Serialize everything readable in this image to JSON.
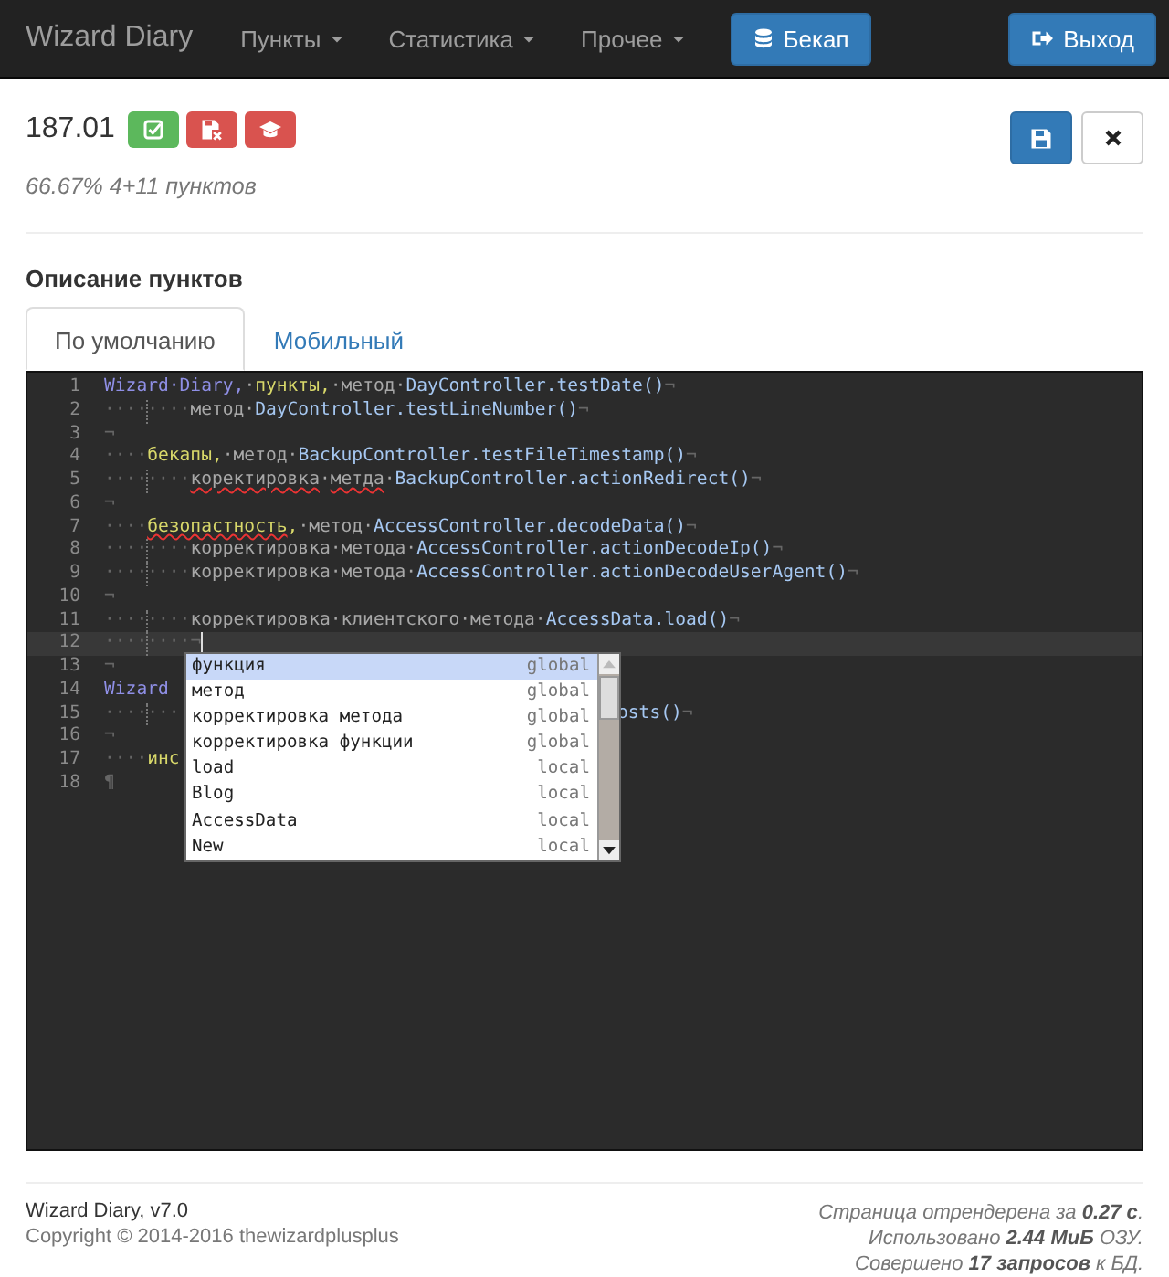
{
  "navbar": {
    "brand": "Wizard Diary",
    "menus": [
      {
        "label": "Пункты"
      },
      {
        "label": "Статистика"
      },
      {
        "label": "Прочее"
      }
    ],
    "backup_button": "Бекап",
    "logout_button": "Выход"
  },
  "header": {
    "title": "187.01",
    "summary": "66.67% 4+11 пунктов",
    "actions": [
      {
        "kind": "check",
        "color": "#5cb85c"
      },
      {
        "kind": "floppy-x",
        "color": "#d9534f"
      },
      {
        "kind": "cap",
        "color": "#d9534f"
      }
    ]
  },
  "section_title": "Описание пунктов",
  "tabs": [
    {
      "label": "По умолчанию",
      "selected": true
    },
    {
      "label": "Мобильный",
      "selected": false
    }
  ],
  "editor": {
    "lines": [
      {
        "number": "1",
        "active": false,
        "tokens": [
          {
            "kind": "title",
            "text": "Wizard·Diary,"
          },
          {
            "kind": "plain",
            "text": "·"
          },
          {
            "kind": "keyword",
            "text": "пункты,"
          },
          {
            "kind": "plain",
            "text": "·метод·"
          },
          {
            "kind": "ref",
            "text": "DayController.testDate()"
          },
          {
            "kind": "ws",
            "text": "¬"
          }
        ]
      },
      {
        "number": "2",
        "active": false,
        "tokens": [
          {
            "kind": "indent",
            "text": "····"
          },
          {
            "kind": "indent",
            "text": "····"
          },
          {
            "kind": "plain",
            "text": "метод·"
          },
          {
            "kind": "ref",
            "text": "DayController.testLineNumber()"
          },
          {
            "kind": "ws",
            "text": "¬"
          }
        ]
      },
      {
        "number": "3",
        "active": false,
        "tokens": [
          {
            "kind": "ws",
            "text": "¬"
          }
        ]
      },
      {
        "number": "4",
        "active": false,
        "tokens": [
          {
            "kind": "indent",
            "text": "····"
          },
          {
            "kind": "keyword",
            "text": "бекапы,"
          },
          {
            "kind": "plain",
            "text": "·метод·"
          },
          {
            "kind": "ref",
            "text": "BackupController.testFileTimestamp()"
          },
          {
            "kind": "ws",
            "text": "¬"
          }
        ]
      },
      {
        "number": "5",
        "active": false,
        "tokens": [
          {
            "kind": "indent",
            "text": "····"
          },
          {
            "kind": "indent",
            "text": "····"
          },
          {
            "kind": "plain",
            "text": "коректировка",
            "misspelled": true
          },
          {
            "kind": "plain",
            "text": "·"
          },
          {
            "kind": "plain",
            "text": "метда",
            "misspelled": true
          },
          {
            "kind": "plain",
            "text": "·"
          },
          {
            "kind": "ref",
            "text": "BackupController.actionRedirect()"
          },
          {
            "kind": "ws",
            "text": "¬"
          }
        ]
      },
      {
        "number": "6",
        "active": false,
        "tokens": [
          {
            "kind": "ws",
            "text": "¬"
          }
        ]
      },
      {
        "number": "7",
        "active": false,
        "tokens": [
          {
            "kind": "indent",
            "text": "····"
          },
          {
            "kind": "keyword",
            "text": "безопастность",
            "misspelled": true
          },
          {
            "kind": "keyword",
            "text": ","
          },
          {
            "kind": "plain",
            "text": "·метод·"
          },
          {
            "kind": "ref",
            "text": "AccessController.decodeData()"
          },
          {
            "kind": "ws",
            "text": "¬"
          }
        ]
      },
      {
        "number": "8",
        "active": false,
        "tokens": [
          {
            "kind": "indent",
            "text": "····"
          },
          {
            "kind": "indent",
            "text": "····"
          },
          {
            "kind": "plain",
            "text": "корректировка·метода·"
          },
          {
            "kind": "ref",
            "text": "AccessController.actionDecodeIp()"
          },
          {
            "kind": "ws",
            "text": "¬"
          }
        ]
      },
      {
        "number": "9",
        "active": false,
        "tokens": [
          {
            "kind": "indent",
            "text": "····"
          },
          {
            "kind": "indent",
            "text": "····"
          },
          {
            "kind": "plain",
            "text": "корректировка·метода·"
          },
          {
            "kind": "ref",
            "text": "AccessController.actionDecodeUserAgent()"
          },
          {
            "kind": "ws",
            "text": "¬"
          }
        ]
      },
      {
        "number": "10",
        "active": false,
        "tokens": [
          {
            "kind": "ws",
            "text": "¬"
          }
        ]
      },
      {
        "number": "11",
        "active": false,
        "tokens": [
          {
            "kind": "indent",
            "text": "····"
          },
          {
            "kind": "indent",
            "text": "····"
          },
          {
            "kind": "plain",
            "text": "корректировка·клиентского·метода·"
          },
          {
            "kind": "ref",
            "text": "AccessData.load()"
          },
          {
            "kind": "ws",
            "text": "¬"
          }
        ]
      },
      {
        "number": "12",
        "active": true,
        "tokens": [
          {
            "kind": "indent",
            "text": "····"
          },
          {
            "kind": "indent",
            "text": "····"
          },
          {
            "kind": "ws",
            "text": "¬"
          }
        ]
      },
      {
        "number": "13",
        "active": false,
        "tokens": [
          {
            "kind": "ws",
            "text": "¬"
          }
        ]
      },
      {
        "number": "14",
        "active": false,
        "tokens": [
          {
            "kind": "title",
            "text": "Wizard"
          }
        ]
      },
      {
        "number": "15",
        "active": false,
        "tokens": [
          {
            "kind": "indent",
            "text": "····"
          },
          {
            "kind": "indent",
            "text": "···"
          }
        ],
        "tail": [
          {
            "kind": "ref",
            "text": "osts()"
          },
          {
            "kind": "ws",
            "text": "¬"
          }
        ]
      },
      {
        "number": "16",
        "active": false,
        "tokens": [
          {
            "kind": "ws",
            "text": "¬"
          }
        ]
      },
      {
        "number": "17",
        "active": false,
        "tokens": [
          {
            "kind": "indent",
            "text": "····"
          },
          {
            "kind": "keyword",
            "text": "инс"
          }
        ]
      },
      {
        "number": "18",
        "active": false,
        "tokens": [
          {
            "kind": "ws",
            "text": "¶"
          }
        ]
      }
    ],
    "completions": [
      {
        "label": "функция",
        "scope": "global",
        "selected": true
      },
      {
        "label": "метод",
        "scope": "global",
        "selected": false
      },
      {
        "label": "корректировка метода",
        "scope": "global",
        "selected": false
      },
      {
        "label": "корректировка функции",
        "scope": "global",
        "selected": false
      },
      {
        "label": "load",
        "scope": "local",
        "selected": false
      },
      {
        "label": "Blog",
        "scope": "local",
        "selected": false
      },
      {
        "label": "AccessData",
        "scope": "local",
        "selected": false
      },
      {
        "label": "New",
        "scope": "local",
        "selected": false
      }
    ]
  },
  "footer": {
    "app": "Wizard Diary, v7.0",
    "copyright": "Copyright © 2014-2016 thewizardplusplus",
    "stats": [
      "Страница отрендерена за **0.27 с**.",
      "Использовано **2.44 МиБ** ОЗУ.",
      "Совершено **17 запросов** к БД."
    ]
  }
}
